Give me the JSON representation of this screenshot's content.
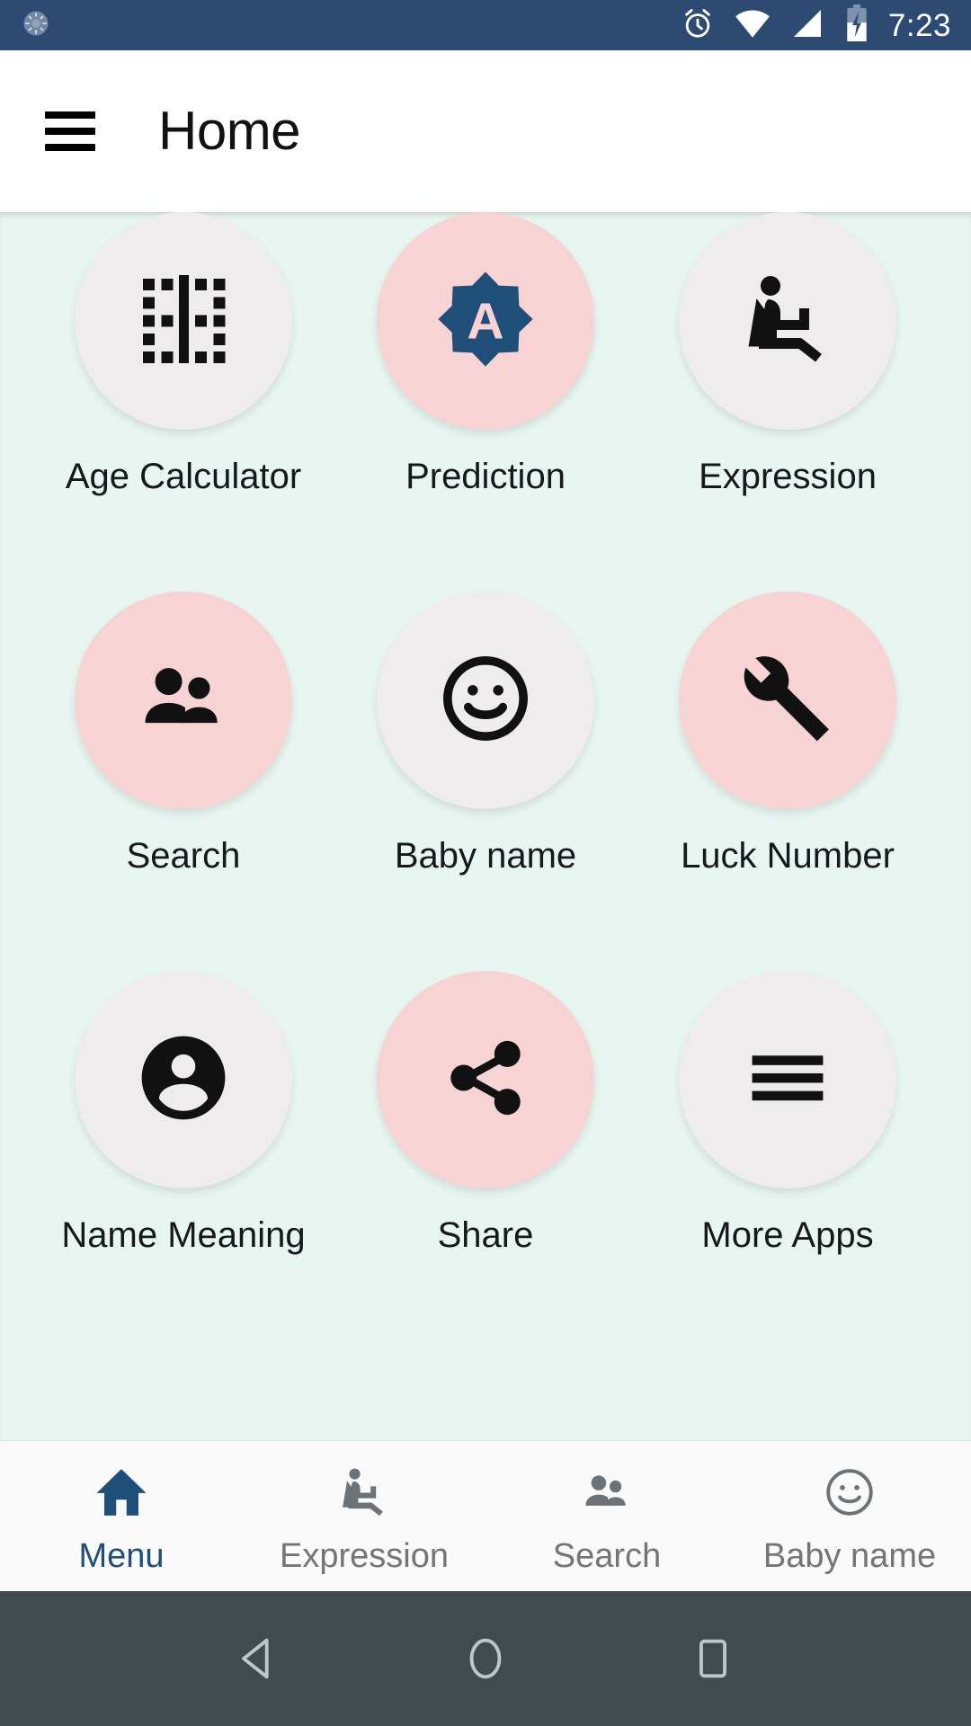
{
  "status_bar": {
    "time": "7:23",
    "background": "#2c4a72",
    "icons": [
      "spinner-icon",
      "alarm-icon",
      "wifi-icon",
      "cellular-signal-icon",
      "battery-charging-icon"
    ]
  },
  "app_bar": {
    "title": "Home",
    "menu_icon": "hamburger-menu-icon",
    "background": "#ffffff"
  },
  "theme": {
    "page_background": "#e8f6f2",
    "tile_grey": "#efecee",
    "tile_pink": "#f8d3d3",
    "accent_blue": "#1f4e79",
    "label_color": "#16191c",
    "inactive_grey": "#757575"
  },
  "grid": {
    "items": [
      {
        "label": "Age Calculator",
        "icon": "border-vertical-icon",
        "tile": "grey"
      },
      {
        "label": "Prediction",
        "icon": "star-badge-a-icon",
        "tile": "pink"
      },
      {
        "label": "Expression",
        "icon": "seat-recline-icon",
        "tile": "grey"
      },
      {
        "label": "Search",
        "icon": "people-icon",
        "tile": "pink"
      },
      {
        "label": "Baby name",
        "icon": "smiley-face-icon",
        "tile": "grey"
      },
      {
        "label": "Luck Number",
        "icon": "wrench-icon",
        "tile": "pink"
      },
      {
        "label": "Name Meaning",
        "icon": "account-circle-icon",
        "tile": "grey"
      },
      {
        "label": "Share",
        "icon": "share-icon",
        "tile": "pink"
      },
      {
        "label": "More Apps",
        "icon": "hamburger-list-icon",
        "tile": "grey"
      }
    ]
  },
  "bottom_nav": {
    "items": [
      {
        "label": "Menu",
        "icon": "home-icon",
        "active": true
      },
      {
        "label": "Expression",
        "icon": "seat-recline-icon",
        "active": false
      },
      {
        "label": "Search",
        "icon": "people-icon",
        "active": false
      },
      {
        "label": "Baby name",
        "icon": "smiley-face-icon",
        "active": false
      }
    ]
  },
  "system_nav": {
    "back": "back-triangle-icon",
    "home": "home-circle-icon",
    "recents": "recents-square-icon",
    "background": "#414a4f"
  }
}
